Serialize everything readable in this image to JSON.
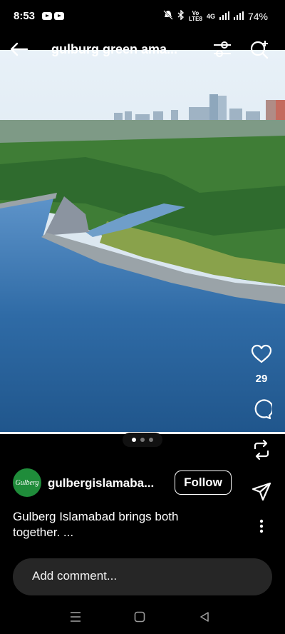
{
  "status_bar": {
    "time": "8:53",
    "network": "4G",
    "volte": "Vo",
    "lte": "LTE8",
    "battery": "74%"
  },
  "top_bar": {
    "title": "gulburg green ama...",
    "back_icon": "arrow-left-icon",
    "filter_icon": "tune-icon",
    "add_icon": "add-search-icon"
  },
  "photo": {
    "description": "Aerial view of lake with dam and city skyline",
    "colors": {
      "sky": "#dfeaf2",
      "water": "#2e6aa5",
      "land": "#3c7d35"
    }
  },
  "actions": {
    "like_count": "29",
    "like_icon": "heart-icon",
    "comment_icon": "comment-icon",
    "repost_icon": "repost-icon",
    "share_icon": "send-icon"
  },
  "pagination": {
    "count": 3,
    "active_index": 0
  },
  "author": {
    "avatar_text": "Gulberg",
    "username": "gulbergislamaba...",
    "follow_label": "Follow"
  },
  "caption": {
    "text": "Gulberg Islamabad brings both together. ..."
  },
  "comment": {
    "placeholder": "Add comment..."
  }
}
